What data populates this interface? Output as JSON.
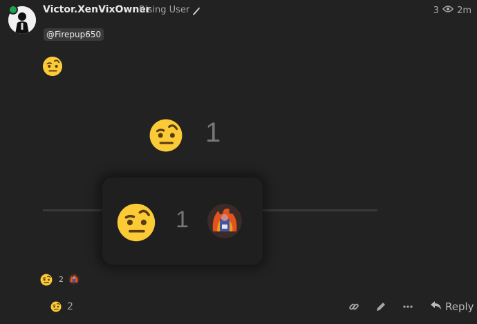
{
  "post": {
    "username": "Victor.XenVixOwner",
    "user_title": "Rising User",
    "views": "3",
    "age": "2m",
    "mention": "@Firepup650"
  },
  "reaction_summary": {
    "big_count": "1",
    "popup_count": "1",
    "small_count": "2"
  },
  "footer": {
    "reaction_count": "2",
    "reply_label": "Reply"
  },
  "icons": [
    "face-with-raised-eyebrow-icon",
    "eye-icon",
    "link-icon",
    "pencil-icon",
    "ellipsis-icon",
    "reply-icon",
    "feather-icon"
  ],
  "colors": {
    "online": "#1ca551",
    "background": "#222222",
    "emoji": "#fbcb37"
  }
}
